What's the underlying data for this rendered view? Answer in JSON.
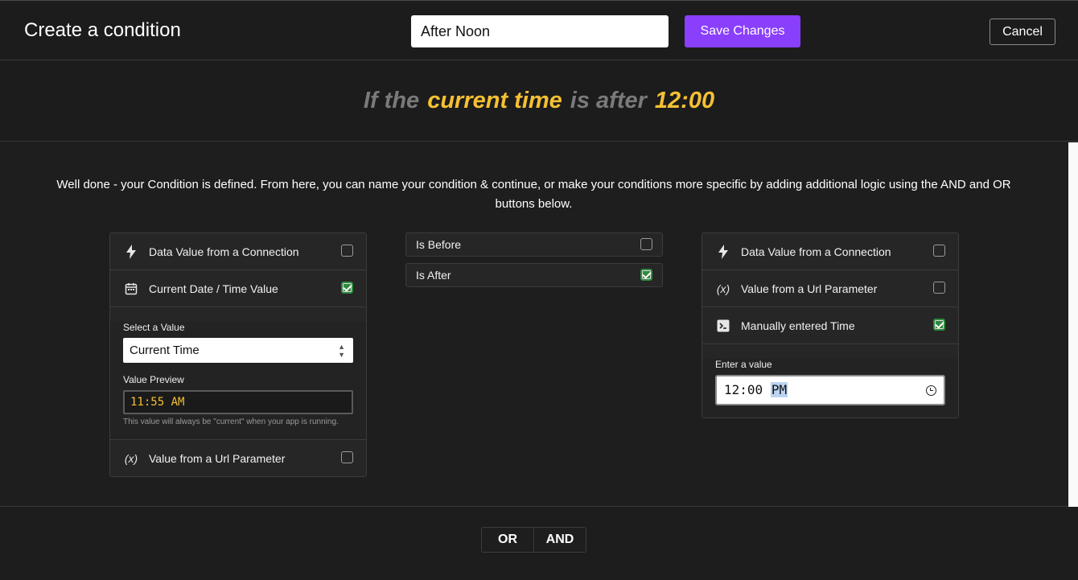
{
  "header": {
    "title": "Create a condition",
    "condition_name_value": "After Noon",
    "save_label": "Save Changes",
    "cancel_label": "Cancel"
  },
  "summary": {
    "w1": "If the",
    "subject": "current time",
    "w2": "is after",
    "value": "12:00"
  },
  "intro_text": "Well done - your Condition is defined. From here, you can name your condition & continue, or make your conditions more specific by adding additional logic using the AND and OR buttons below.",
  "left_panel": {
    "options": [
      {
        "label": "Data Value from a Connection",
        "icon": "bolt-icon",
        "checked": false
      },
      {
        "label": "Current Date / Time Value",
        "icon": "calendar-icon",
        "checked": true
      },
      {
        "label": "Value from a Url Parameter",
        "icon": "variable-icon",
        "checked": false
      }
    ],
    "select_label": "Select a Value",
    "select_value": "Current Time",
    "preview_label": "Value Preview",
    "preview_value": "11:55 AM",
    "hint": "This value will always be \"current\" when your app is running."
  },
  "operators": [
    {
      "label": "Is Before",
      "checked": false
    },
    {
      "label": "Is After",
      "checked": true
    }
  ],
  "right_panel": {
    "options": [
      {
        "label": "Data Value from a Connection",
        "icon": "bolt-icon",
        "checked": false
      },
      {
        "label": "Value from a Url Parameter",
        "icon": "variable-icon",
        "checked": false
      },
      {
        "label": "Manually entered Time",
        "icon": "terminal-icon",
        "checked": true
      }
    ],
    "enter_label": "Enter a value",
    "time_value": "12:00",
    "time_ampm": "PM"
  },
  "logic": {
    "or_label": "OR",
    "and_label": "AND"
  },
  "colors": {
    "accent": "#8a3ffc",
    "highlight": "#f5c033",
    "checked": "#2f8a3e"
  }
}
